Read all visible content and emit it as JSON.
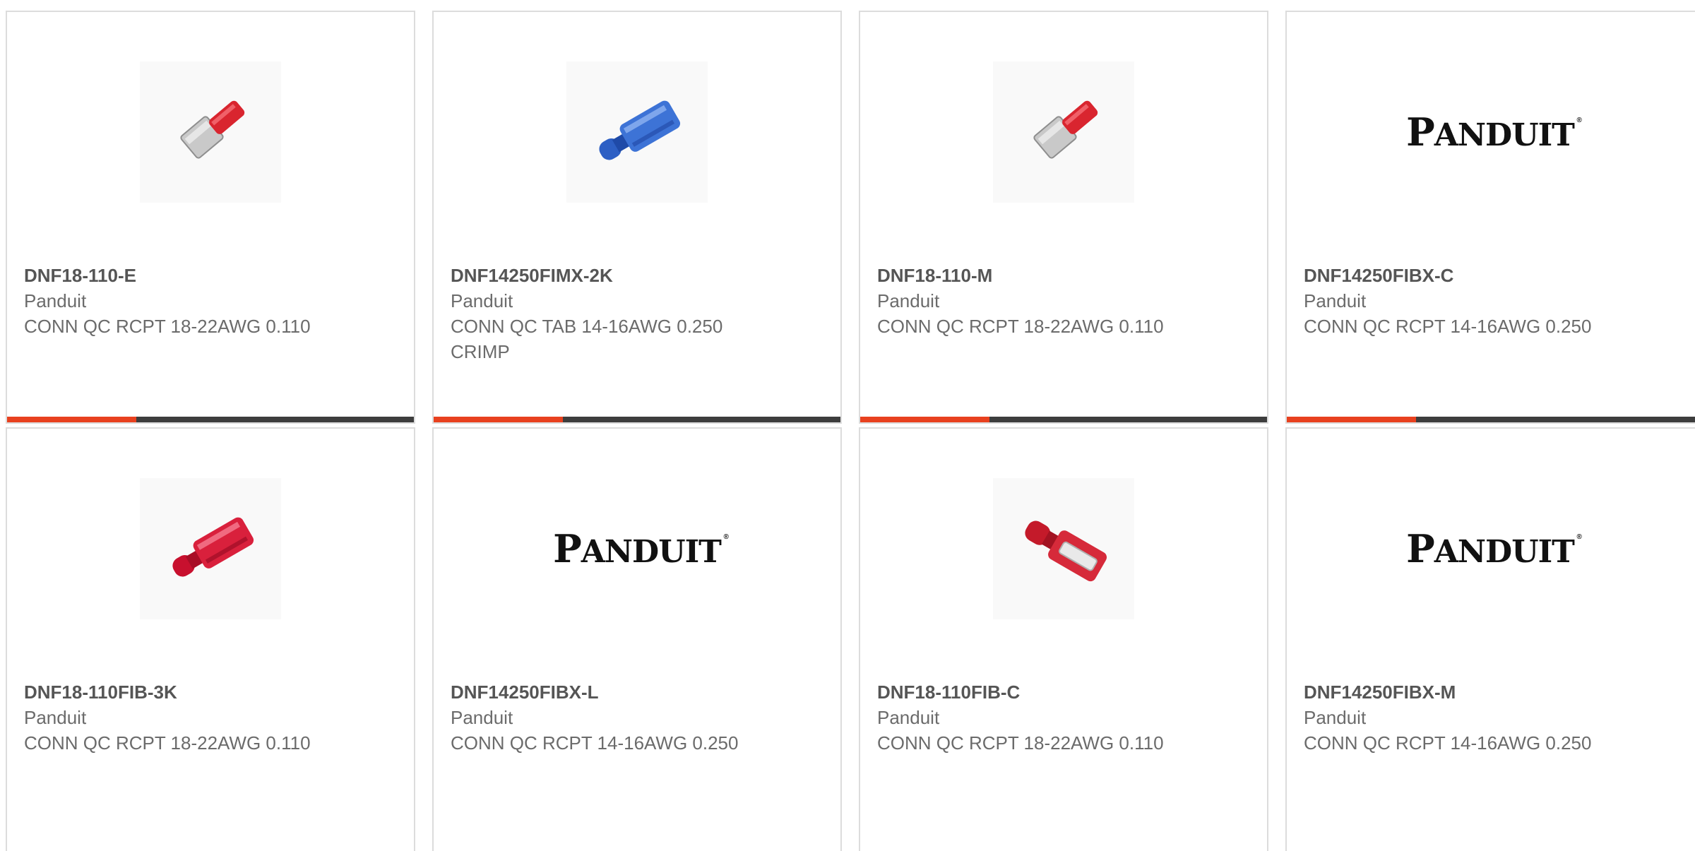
{
  "colors": {
    "accent": "#e8411f",
    "bar": "#3d3d3d",
    "border": "#dcdcdc",
    "text_bold": "#555555",
    "text": "#6b6b6b"
  },
  "logo": {
    "big_letter": "P",
    "rest": "ANDUIT",
    "reg": "®"
  },
  "products": [
    {
      "part": "DNF18-110-E",
      "manufacturer": "Panduit",
      "description": "CONN QC RCPT 18-22AWG 0.110",
      "image": "red-receptacle-metal-icon"
    },
    {
      "part": "DNF14250FIMX-2K",
      "manufacturer": "Panduit",
      "description": "CONN QC TAB 14-16AWG 0.250 CRIMP",
      "image": "blue-tab-icon"
    },
    {
      "part": "DNF18-110-M",
      "manufacturer": "Panduit",
      "description": "CONN QC RCPT 18-22AWG 0.110",
      "image": "red-receptacle-metal-icon"
    },
    {
      "part": "DNF14250FIBX-C",
      "manufacturer": "Panduit",
      "description": "CONN QC RCPT 14-16AWG 0.250",
      "image": "panduit-logo"
    },
    {
      "part": "DNF18-110FIB-3K",
      "manufacturer": "Panduit",
      "description": "CONN QC RCPT 18-22AWG 0.110",
      "image": "red-insulated-receptacle-icon"
    },
    {
      "part": "DNF14250FIBX-L",
      "manufacturer": "Panduit",
      "description": "CONN QC RCPT 14-16AWG 0.250",
      "image": "panduit-logo"
    },
    {
      "part": "DNF18-110FIB-C",
      "manufacturer": "Panduit",
      "description": "CONN QC RCPT 18-22AWG 0.110",
      "image": "red-flat-receptacle-icon"
    },
    {
      "part": "DNF14250FIBX-M",
      "manufacturer": "Panduit",
      "description": "CONN QC RCPT 14-16AWG 0.250",
      "image": "panduit-logo"
    }
  ]
}
